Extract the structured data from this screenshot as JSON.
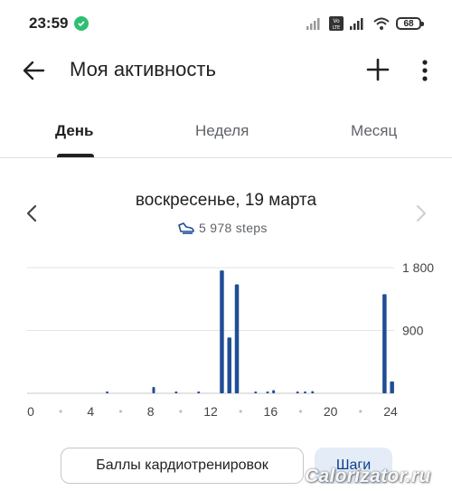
{
  "status_bar": {
    "time": "23:59",
    "battery": "68"
  },
  "header": {
    "title": "Моя активность"
  },
  "tabs": [
    {
      "label": "День",
      "selected": true
    },
    {
      "label": "Неделя",
      "selected": false
    },
    {
      "label": "Месяц",
      "selected": false
    }
  ],
  "day": {
    "date_label": "воскресенье, 19 марта",
    "steps_text": "5 978 steps"
  },
  "chart_data": {
    "type": "bar",
    "x_ticks": [
      "0",
      "4",
      "8",
      "12",
      "16",
      "20",
      "24"
    ],
    "y_ticks": [
      "900",
      "1 800"
    ],
    "ylim": [
      0,
      1800
    ],
    "xlim": [
      0,
      24
    ],
    "series": [
      {
        "x": [
          5.1,
          8.2,
          9.7,
          11.2,
          12.75,
          13.25,
          13.75,
          15.0,
          15.8,
          16.2,
          17.8,
          18.3,
          18.8,
          23.6,
          24.1
        ],
        "values": [
          10,
          90,
          15,
          10,
          1760,
          800,
          1560,
          10,
          25,
          45,
          10,
          15,
          30,
          1420,
          170
        ]
      }
    ],
    "bar_color": "#1f4e96"
  },
  "chips": {
    "cardio": "Баллы кардиотренировок",
    "steps": "Шаги"
  },
  "watermark": "Calorizator.ru"
}
